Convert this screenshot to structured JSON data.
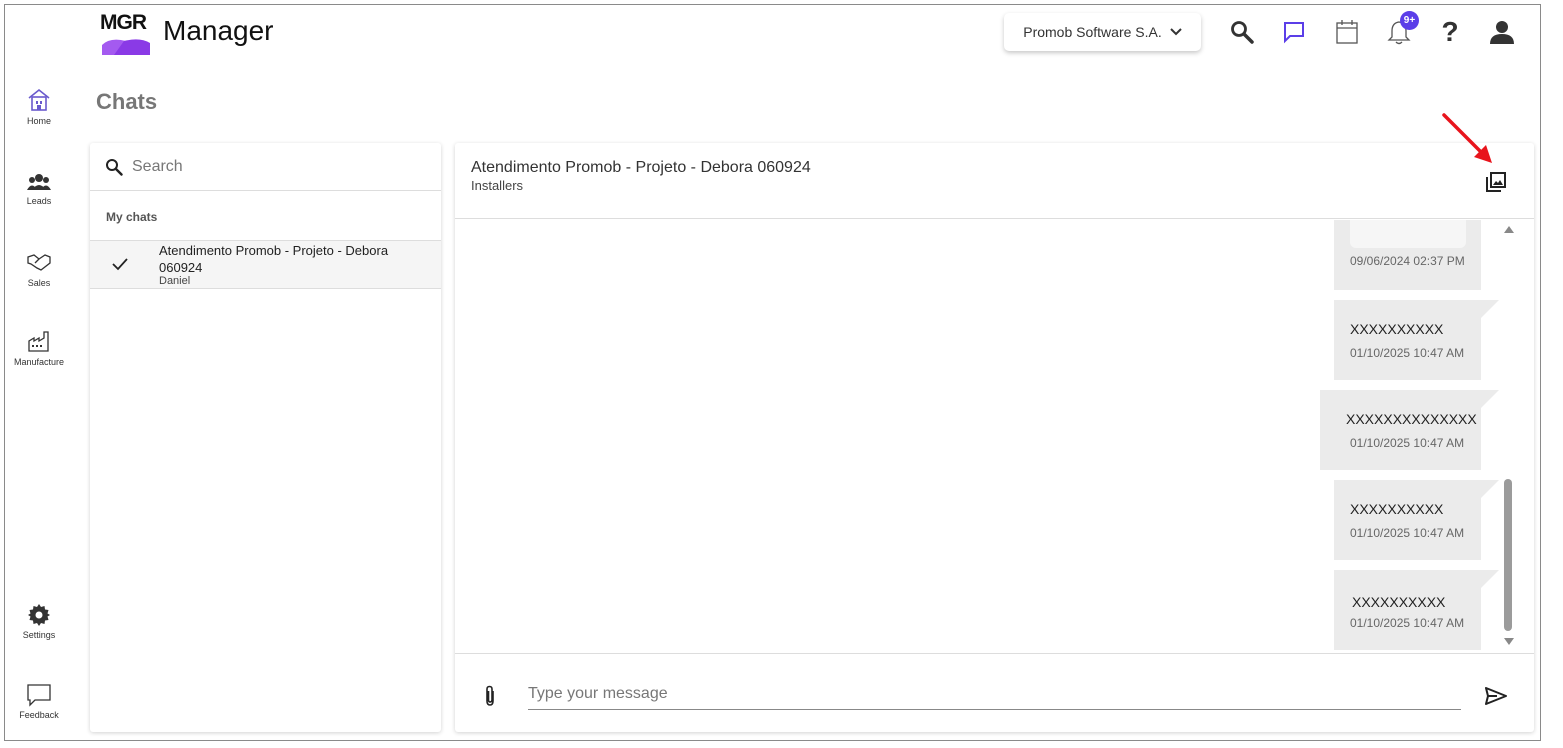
{
  "app": {
    "logo": "MGR",
    "name": "Manager"
  },
  "header": {
    "company": "Promob Software S.A.",
    "notification_badge": "9+",
    "icons": [
      "search-icon",
      "chat-icon",
      "calendar-icon",
      "bell-icon",
      "help-icon",
      "user-icon"
    ],
    "accent": "#5b3ee8"
  },
  "sidebar": {
    "items": [
      {
        "label": "Home",
        "icon": "home-icon"
      },
      {
        "label": "Leads",
        "icon": "people-icon"
      },
      {
        "label": "Sales",
        "icon": "handshake-icon"
      },
      {
        "label": "Manufacture",
        "icon": "factory-icon"
      },
      {
        "label": "Settings",
        "icon": "gear-icon"
      },
      {
        "label": "Feedback",
        "icon": "feedback-icon"
      }
    ]
  },
  "page": {
    "title": "Chats"
  },
  "chat_list": {
    "search_placeholder": "Search",
    "section": "My chats",
    "chats": [
      {
        "title": "Atendimento Promob - Projeto - Debora 060924",
        "subtitle": "Daniel",
        "selected": true
      }
    ]
  },
  "conversation": {
    "title": "Atendimento Promob - Projeto - Debora 060924",
    "subtitle": "Installers",
    "messages": [
      {
        "text": "",
        "time": "09/06/2024 02:37 PM",
        "has_media": true
      },
      {
        "text": "XXXXXXXXXX",
        "time": "01/10/2025 10:47 AM"
      },
      {
        "text": "XXXXXXXXXXXXXX",
        "time": "01/10/2025 10:47 AM"
      },
      {
        "text": "XXXXXXXXXX",
        "time": "01/10/2025 10:47 AM"
      },
      {
        "text": "XXXXXXXXXX",
        "time": "01/10/2025 10:47 AM"
      }
    ],
    "composer_placeholder": "Type your message"
  }
}
